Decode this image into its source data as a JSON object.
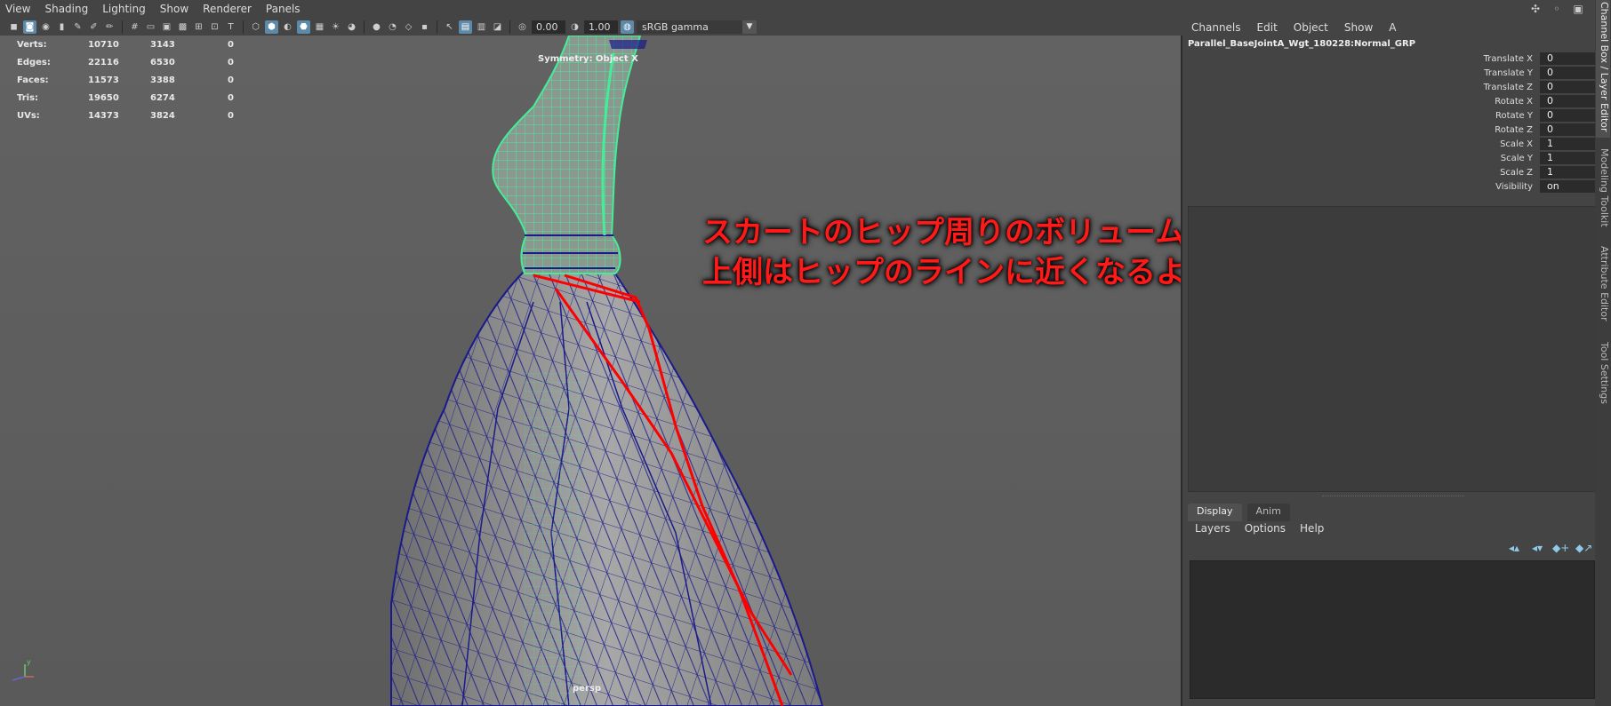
{
  "panel_menu": [
    "View",
    "Shading",
    "Lighting",
    "Show",
    "Renderer",
    "Panels"
  ],
  "toolbar": {
    "gain": "0.00",
    "gamma": "1.00",
    "color_space": "sRGB gamma"
  },
  "hud": {
    "rows": [
      {
        "label": "Verts:",
        "c1": "10710",
        "c2": "3143",
        "c3": "0"
      },
      {
        "label": "Edges:",
        "c1": "22116",
        "c2": "6530",
        "c3": "0"
      },
      {
        "label": "Faces:",
        "c1": "11573",
        "c2": "3388",
        "c3": "0"
      },
      {
        "label": "Tris:",
        "c1": "19650",
        "c2": "6274",
        "c3": "0"
      },
      {
        "label": "UVs:",
        "c1": "14373",
        "c2": "3824",
        "c3": "0"
      }
    ]
  },
  "symmetry_label": "Symmetry: Object X",
  "camera_label": "persp",
  "annotation": {
    "line1": "スカートのヒップ周りのボリュームを減らして、",
    "line2": "上側はヒップのラインに近くなるようにしてください。"
  },
  "channel_box": {
    "menu": [
      "Channels",
      "Edit",
      "Object",
      "Show",
      "A"
    ],
    "node_name": "Parallel_BaseJointA_Wgt_180228:Normal_GRP",
    "channels": [
      {
        "label": "Translate X",
        "value": "0"
      },
      {
        "label": "Translate Y",
        "value": "0"
      },
      {
        "label": "Translate Z",
        "value": "0"
      },
      {
        "label": "Rotate X",
        "value": "0"
      },
      {
        "label": "Rotate Y",
        "value": "0"
      },
      {
        "label": "Rotate Z",
        "value": "0"
      },
      {
        "label": "Scale X",
        "value": "1"
      },
      {
        "label": "Scale Y",
        "value": "1"
      },
      {
        "label": "Scale Z",
        "value": "1"
      },
      {
        "label": "Visibility",
        "value": "on"
      }
    ]
  },
  "layer_editor": {
    "tabs": [
      "Display",
      "Anim"
    ],
    "menu": [
      "Layers",
      "Options",
      "Help"
    ]
  },
  "vertical_tabs": [
    "Channel Box / Layer Editor",
    "Modeling Toolkit",
    "Attribute Editor",
    "Tool Settings"
  ],
  "colors": {
    "annotation": "#ff1a1a",
    "wireframe_selected": "#44ee99",
    "wireframe": "#1a1a8a",
    "guide_line": "#ff0000"
  }
}
